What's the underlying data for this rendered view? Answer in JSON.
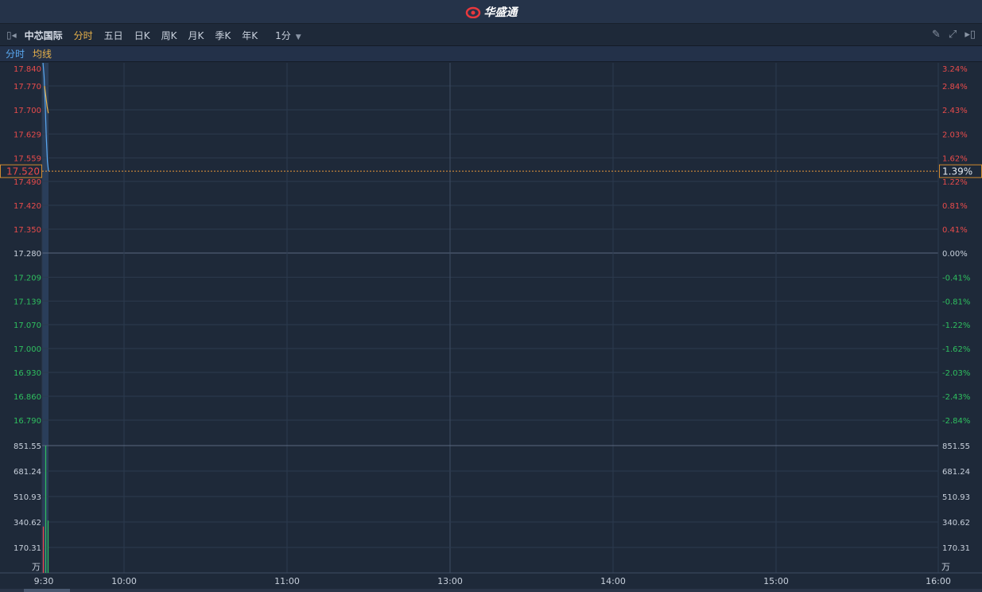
{
  "app": {
    "title": "华盛通",
    "logo_icon": "flame-logo-icon"
  },
  "toolbar": {
    "stock_name": "中芯国际",
    "tabs": [
      "分时",
      "五日",
      "日K",
      "周K",
      "月K",
      "季K",
      "年K"
    ],
    "active_tab": "分时",
    "interval": "1分"
  },
  "legend": {
    "price": "分时",
    "avg": "均线"
  },
  "colors": {
    "up": "#e84b4b",
    "down": "#2fbf5f",
    "price_line": "#5aa8f0",
    "avg_line": "#e8b24a",
    "active": "#e8b24a"
  },
  "chart_data": {
    "type": "line",
    "prev_close": 17.28,
    "price_ticks": [
      "17.840",
      "17.770",
      "17.700",
      "17.629",
      "17.559",
      "17.490",
      "17.420",
      "17.350",
      "17.280",
      "17.209",
      "17.139",
      "17.070",
      "17.000",
      "16.930",
      "16.860",
      "16.790"
    ],
    "pct_ticks": [
      "3.24%",
      "2.84%",
      "2.43%",
      "2.03%",
      "1.62%",
      "1.22%",
      "0.81%",
      "0.41%",
      "0.00%",
      "-0.41%",
      "-0.81%",
      "-1.22%",
      "-1.62%",
      "-2.03%",
      "-2.43%",
      "-2.84%"
    ],
    "ylim": [
      16.72,
      17.84
    ],
    "current_price": "17.520",
    "current_pct": "1.39%",
    "price_series": [
      17.84,
      17.8,
      17.72,
      17.62,
      17.55,
      17.52
    ],
    "avg_series": [
      17.77,
      17.74,
      17.71,
      17.69
    ],
    "volume_ticks": [
      "851.55",
      "681.24",
      "510.93",
      "340.62",
      "170.31"
    ],
    "volume_unit": "万",
    "volume_max": 851.55,
    "volume": [
      {
        "value": 310,
        "dir": "up"
      },
      {
        "value": 851.55,
        "dir": "down"
      },
      {
        "value": 350,
        "dir": "down"
      }
    ],
    "x_ticks": [
      "9:30",
      "10:00",
      "11:00",
      "13:00",
      "14:00",
      "15:00",
      "16:00"
    ]
  }
}
